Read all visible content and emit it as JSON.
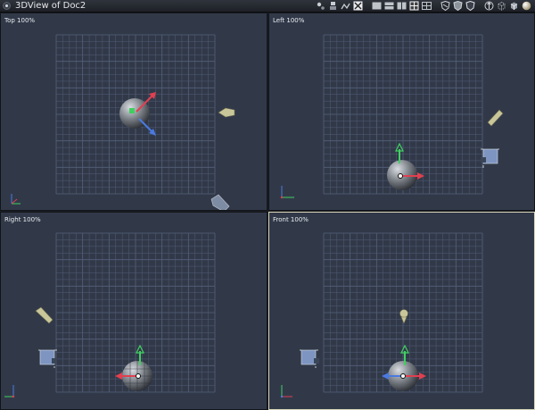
{
  "window": {
    "title": "3DView of Doc2"
  },
  "toolbar": {
    "icons": [
      "move-tool-icon",
      "scale-tool-icon",
      "bones-tool-icon",
      "target-icon",
      "layout-single-icon",
      "layout-two-icon",
      "layout-four-icon",
      "layout-grid-icon",
      "wireframe-shield-icon",
      "shaded-shield-icon",
      "shield-outline-icon",
      "light-icon",
      "cube-wire-icon",
      "cube-solid-icon",
      "sphere-icon"
    ]
  },
  "viewports": [
    {
      "name": "top",
      "label": "Top 100%"
    },
    {
      "name": "left",
      "label": "Left 100%"
    },
    {
      "name": "right",
      "label": "Right 100%"
    },
    {
      "name": "front",
      "label": "Front 100%"
    }
  ],
  "colors": {
    "background": "#313949",
    "grid": "#55607a",
    "active_border": "#d9d6b8",
    "x_axis": "#e04050",
    "y_axis": "#40d060",
    "z_axis": "#4a7ae0"
  }
}
